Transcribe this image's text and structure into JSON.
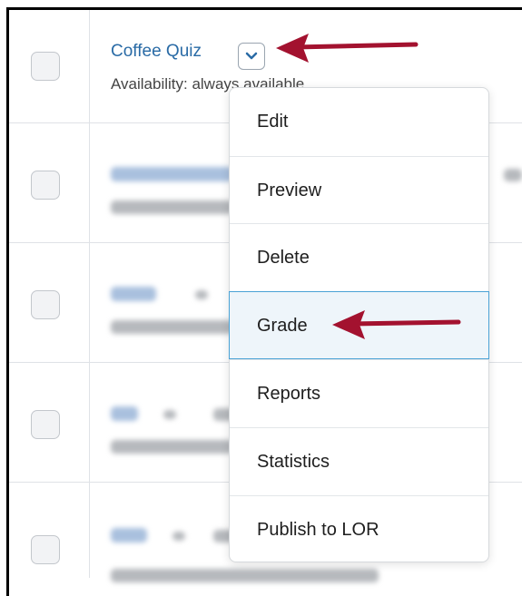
{
  "quiz": {
    "title": "Coffee Quiz",
    "availability": "Availability: always available"
  },
  "menu": {
    "items": [
      {
        "label": "Edit"
      },
      {
        "label": "Preview"
      },
      {
        "label": "Delete"
      },
      {
        "label": "Grade"
      },
      {
        "label": "Reports"
      },
      {
        "label": "Statistics"
      },
      {
        "label": "Publish to LOR"
      }
    ],
    "highlighted": "Grade"
  },
  "colors": {
    "link": "#2a6ba6",
    "arrow": "#a3122f",
    "highlight_border": "#4aa2d5",
    "highlight_bg": "#eef5fa"
  },
  "icons": {
    "caret": "chevron-down-icon",
    "pointer": "arrow-left-icon"
  }
}
